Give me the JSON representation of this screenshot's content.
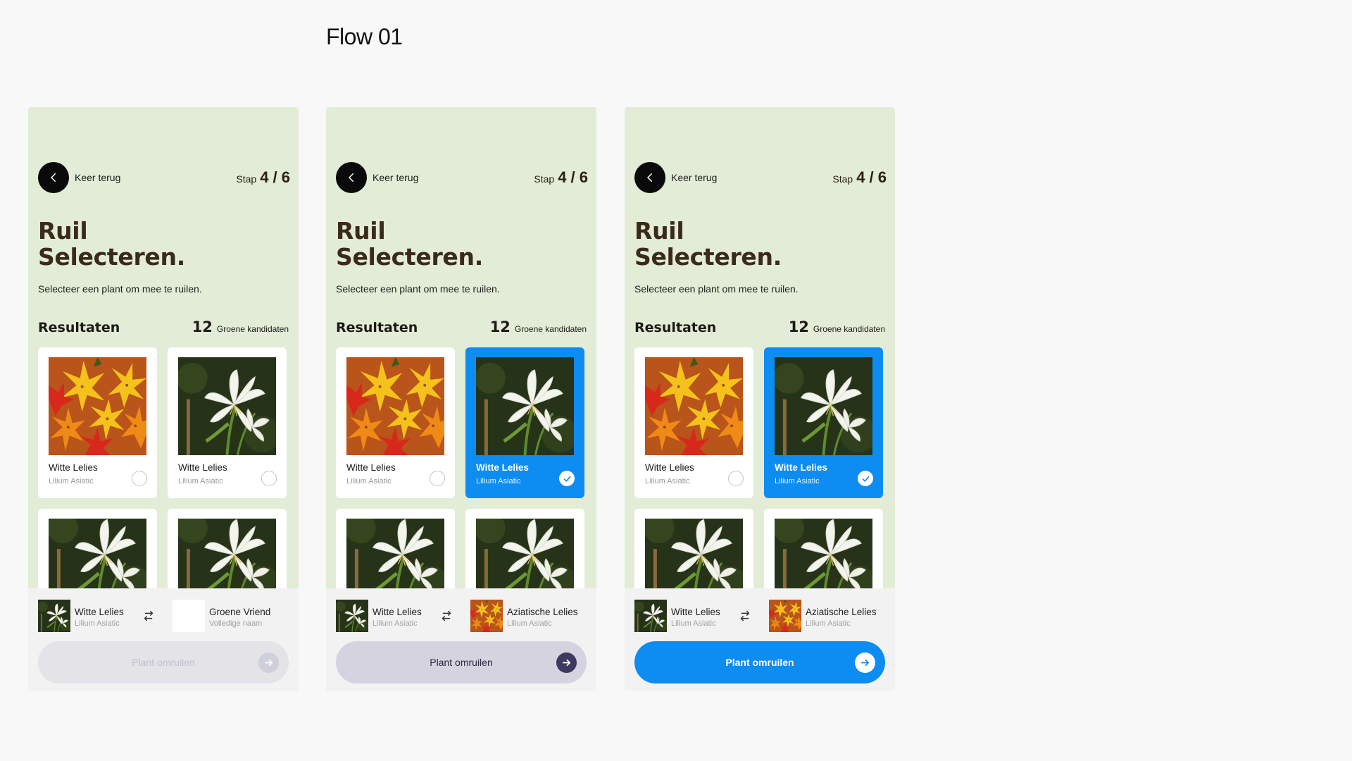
{
  "flow_title": "Flow 01",
  "colors": {
    "screen_bg": "#e2ecd6",
    "accent_blue": "#0d8cf2",
    "heading_brown": "#3b2a1b",
    "back_button": "#0a0a0a"
  },
  "screens": [
    {
      "back_label": "Keer terug",
      "step_label": "Stap",
      "step_value": "4 / 6",
      "heading_line1": "Ruil",
      "heading_line2": "Selecteren.",
      "subtitle": "Selecteer een plant om mee te ruilen.",
      "results_title": "Resultaten",
      "results_count": "12",
      "results_count_label": "Groene kandidaten",
      "cards": [
        {
          "name": "Witte Lelies",
          "sci": "Lilium Asiatic",
          "image": "orange-lilies",
          "selected": false
        },
        {
          "name": "Witte Lelies",
          "sci": "Lilium Asiatic",
          "image": "white-lily",
          "selected": false
        }
      ],
      "swap_a_name": "Witte Lelies",
      "swap_a_sub": "Lilium Asiatic",
      "swap_b_name": "Groene Vriend",
      "swap_b_sub": "Volledige naam",
      "cta_label": "Plant omruilen",
      "cta_state": "disabled"
    },
    {
      "back_label": "Keer terug",
      "step_label": "Stap",
      "step_value": "4 / 6",
      "heading_line1": "Ruil",
      "heading_line2": "Selecteren.",
      "subtitle": "Selecteer een plant om mee te ruilen.",
      "results_title": "Resultaten",
      "results_count": "12",
      "results_count_label": "Groene kandidaten",
      "cards": [
        {
          "name": "Witte Lelies",
          "sci": "Lilium Asiatic",
          "image": "orange-lilies",
          "selected": false
        },
        {
          "name": "Witte Lelies",
          "sci": "Lilium Asiatic",
          "image": "white-lily",
          "selected": true
        }
      ],
      "swap_a_name": "Witte Lelies",
      "swap_a_sub": "Lilium Asiatic",
      "swap_b_name": "Aziatische Lelies",
      "swap_b_sub": "Lilium Asiatic",
      "cta_label": "Plant omruilen",
      "cta_state": "neutral"
    },
    {
      "back_label": "Keer terug",
      "step_label": "Stap",
      "step_value": "4 / 6",
      "heading_line1": "Ruil",
      "heading_line2": "Selecteren.",
      "subtitle": "Selecteer een plant om mee te ruilen.",
      "results_title": "Resultaten",
      "results_count": "12",
      "results_count_label": "Groene kandidaten",
      "cards": [
        {
          "name": "Witte Lelies",
          "sci": "Lilium Asiatic",
          "image": "orange-lilies",
          "selected": false
        },
        {
          "name": "Witte Lelies",
          "sci": "Lilium Asiatic",
          "image": "white-lily",
          "selected": true
        }
      ],
      "swap_a_name": "Witte Lelies",
      "swap_a_sub": "Lilium Asiatic",
      "swap_b_name": "Aziatische Lelies",
      "swap_b_sub": "Lilium Asiatic",
      "cta_label": "Plant omruilen",
      "cta_state": "active"
    }
  ]
}
